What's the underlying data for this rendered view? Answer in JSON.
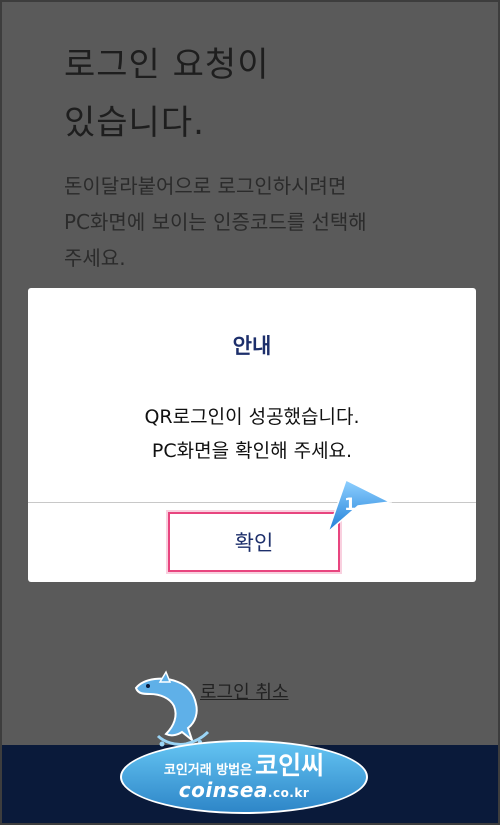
{
  "page": {
    "title_lines": [
      "로그인 요청이",
      "있습니다."
    ],
    "description_lines": [
      "돈이달라붙어으로 로그인하시려면",
      "PC화면에 보이는 인증코드를 선택해",
      "주세요."
    ],
    "cancel_label": "로그인 취소"
  },
  "dialog": {
    "title": "안내",
    "message_lines": [
      "QR로그인이 성공했습니다.",
      "PC화면을 확인해 주세요."
    ],
    "confirm_label": "확인"
  },
  "annotation": {
    "step_number": "1"
  },
  "watermark": {
    "tagline": "코인거래 방법은",
    "brand": "코인씨",
    "site_name": "coinsea",
    "site_tld": ".co.kr"
  },
  "colors": {
    "overlay_background": "#5a5a5a",
    "dialog_title": "#1d2f6b",
    "highlight_border": "#e8457f",
    "marker_blue": "#2d8ee0",
    "footer": "#0a1a3a"
  }
}
